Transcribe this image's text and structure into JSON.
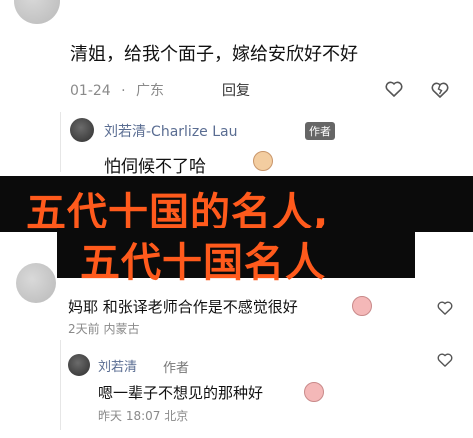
{
  "comment1": {
    "text": "清姐，给我个面子，嫁给安欣好不好",
    "date": "01-24",
    "separator": "·",
    "location": "广东",
    "reply_label": "回复"
  },
  "comment2": {
    "user": "刘若清-Charlize Lau",
    "author_tag": "作者",
    "text": "怕伺候不了哈"
  },
  "banner": {
    "line1": "五代十国的名人,",
    "line2": "五代十国名人"
  },
  "comment3": {
    "text": "妈耶 和张译老师合作是不感觉很好",
    "meta": "2天前 内蒙古"
  },
  "comment4": {
    "user": "刘若清",
    "author_tag": "作者",
    "text": "嗯一辈子不想见的那种好",
    "meta": "昨天 18:07 北京"
  },
  "colors": {
    "banner_bg": "#0b0b0b",
    "banner_text": "#ff5a1c",
    "meta_blue": "#5a6d92"
  }
}
